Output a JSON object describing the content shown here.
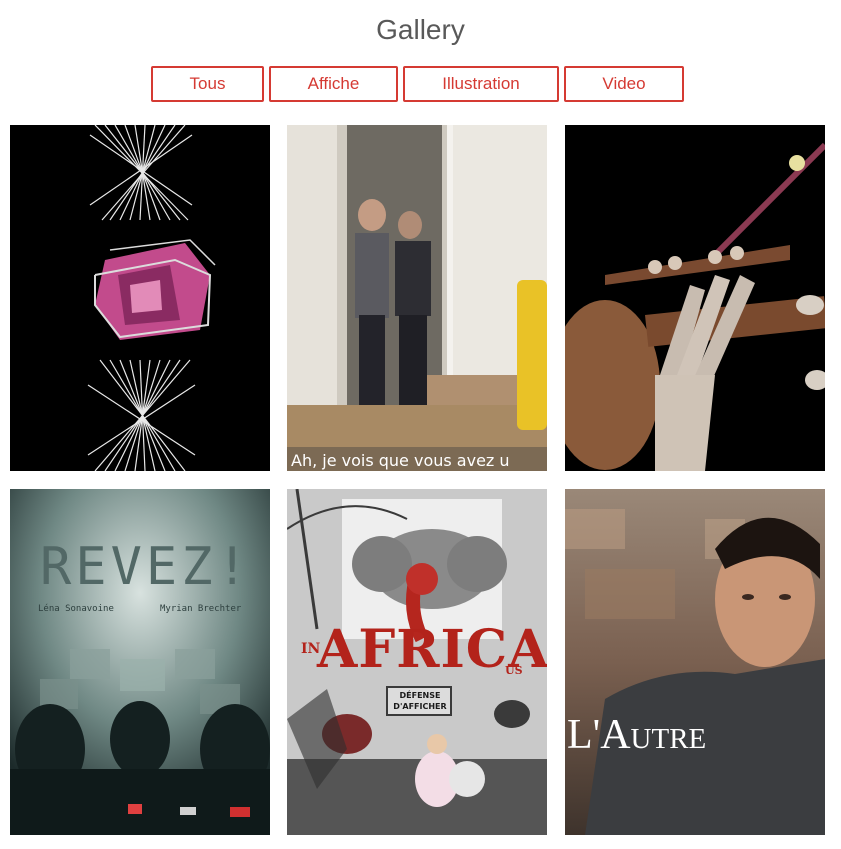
{
  "gallery": {
    "title": "Gallery",
    "filters": [
      {
        "label": "Tous"
      },
      {
        "label": "Affiche"
      },
      {
        "label": "Illustration"
      },
      {
        "label": "Video"
      }
    ],
    "items": [
      {
        "kind": "illustration",
        "caption": ""
      },
      {
        "kind": "video",
        "caption": "Ah, je vois que vous avez u"
      },
      {
        "kind": "illustration",
        "caption": ""
      },
      {
        "kind": "affiche",
        "title_text": "REVEZ!",
        "names": [
          "Léna Sonavoine",
          "Myrian Brechter"
        ]
      },
      {
        "kind": "affiche",
        "title_text": "AFRICA",
        "prefix": "IN",
        "suffix": "US",
        "sign_line1": "DÉFENSE",
        "sign_line2": "D'AFFICHER"
      },
      {
        "kind": "affiche",
        "title_text": "L'Autre"
      }
    ]
  },
  "colors": {
    "accent": "#d53a33",
    "title": "#595959"
  }
}
